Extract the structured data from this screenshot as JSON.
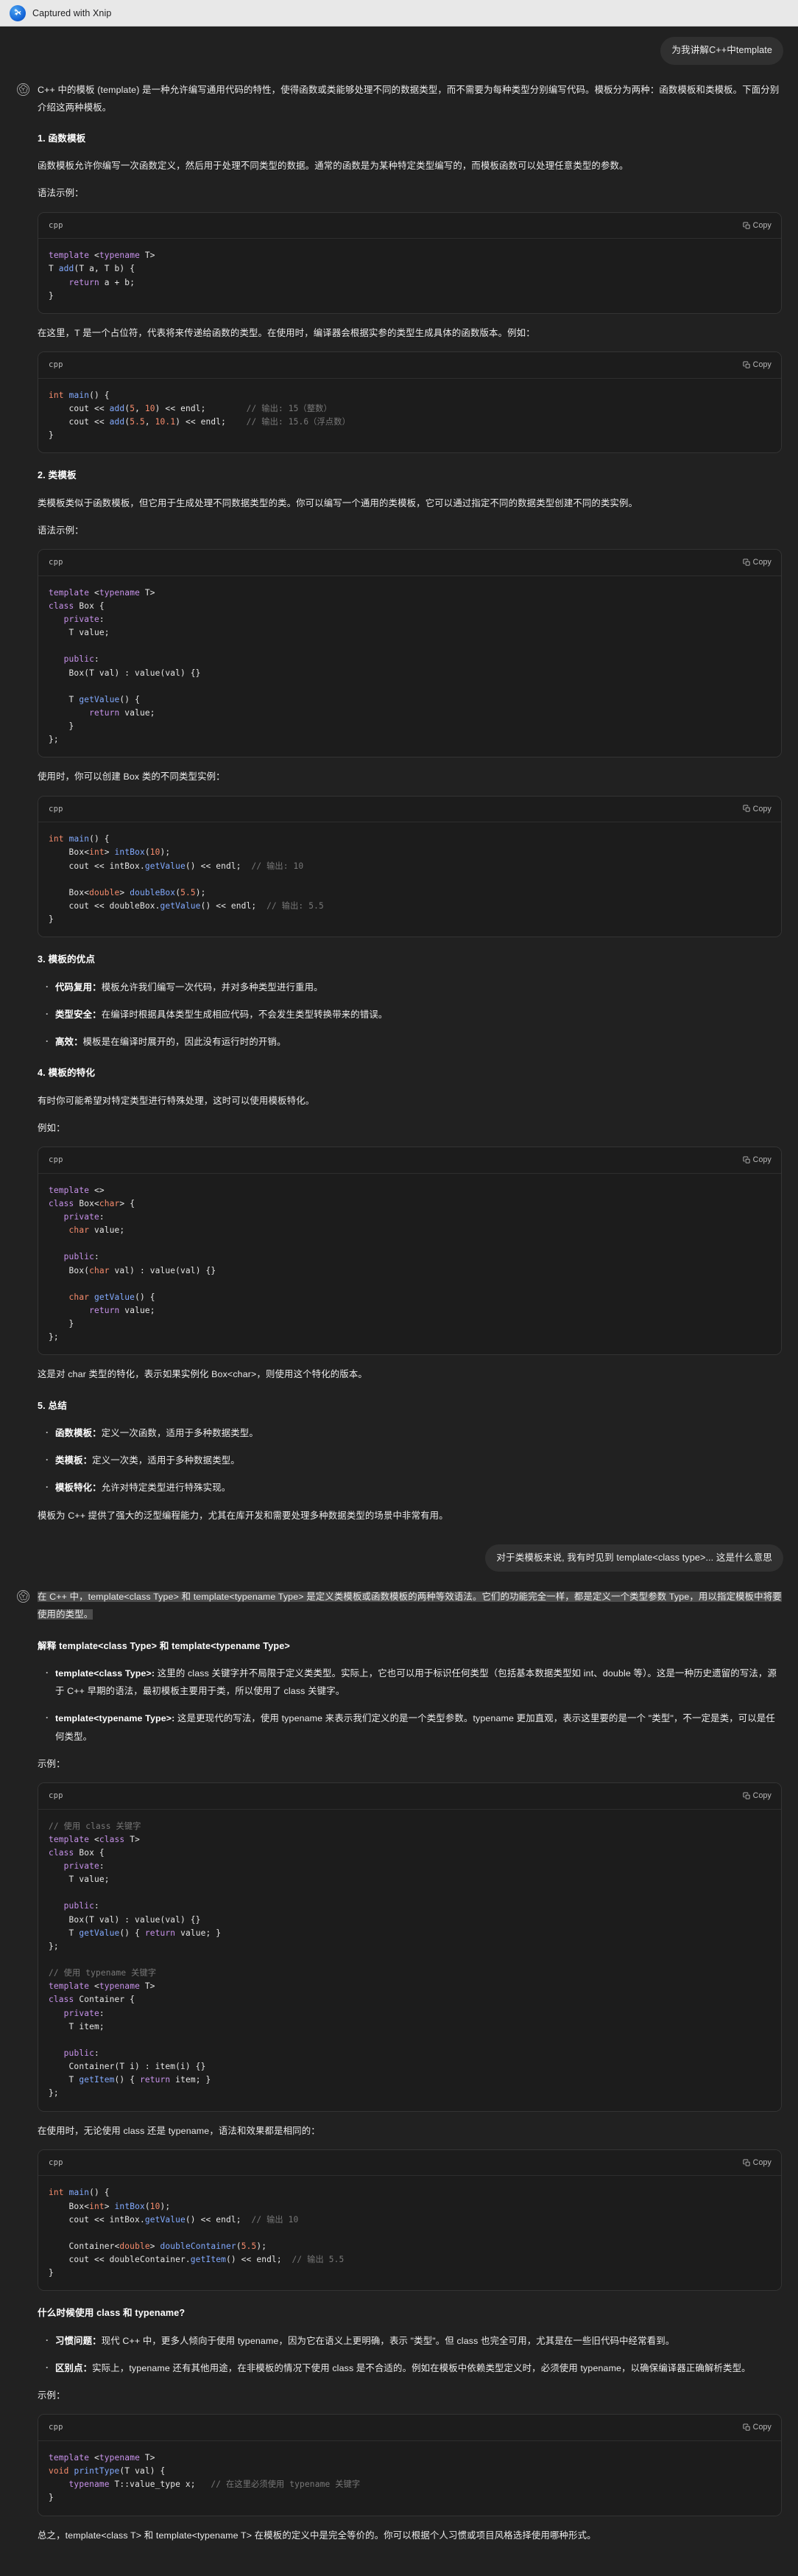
{
  "titlebar": {
    "app_name": "Captured with Xnip",
    "logo_icon": "xnip-scissors-icon"
  },
  "code_ui": {
    "lang_label": "cpp",
    "copy_label": "Copy",
    "copy_icon": "copy-icon"
  },
  "conversation": [
    {
      "role": "user",
      "text": "为我讲解C++中template"
    },
    {
      "role": "assistant",
      "blocks": [
        {
          "type": "p",
          "text": "C++ 中的模板 (template) 是一种允许编写通用代码的特性，使得函数或类能够处理不同的数据类型，而不需要为每种类型分别编写代码。模板分为两种：函数模板和类模板。下面分别介绍这两种模板。"
        },
        {
          "type": "h3",
          "text": "1. 函数模板"
        },
        {
          "type": "p",
          "text": "函数模板允许你编写一次函数定义，然后用于处理不同类型的数据。通常的函数是为某种特定类型编写的，而模板函数可以处理任意类型的参数。"
        },
        {
          "type": "p",
          "text": "语法示例："
        },
        {
          "type": "code",
          "lang": "cpp",
          "lines": "template <typename T>\nT add(T a, T b) {\n    return a + b;\n}"
        },
        {
          "type": "p",
          "text": "在这里，T 是一个占位符，代表将来传递给函数的类型。在使用时，编译器会根据实参的类型生成具体的函数版本。例如："
        },
        {
          "type": "code",
          "lang": "cpp",
          "lines": "int main() {\n    cout << add(5, 10) << endl;        // 输出: 15（整数）\n    cout << add(5.5, 10.1) << endl;    // 输出: 15.6（浮点数）\n}"
        },
        {
          "type": "h3",
          "text": "2. 类模板"
        },
        {
          "type": "p",
          "text": "类模板类似于函数模板，但它用于生成处理不同数据类型的类。你可以编写一个通用的类模板，它可以通过指定不同的数据类型创建不同的类实例。"
        },
        {
          "type": "p",
          "text": "语法示例："
        },
        {
          "type": "code",
          "lang": "cpp",
          "lines": "template <typename T>\nclass Box {\n   private:\n    T value;\n\n   public:\n    Box(T val) : value(val) {}\n\n    T getValue() {\n        return value;\n    }\n};"
        },
        {
          "type": "p",
          "text": "使用时，你可以创建 Box 类的不同类型实例："
        },
        {
          "type": "code",
          "lang": "cpp",
          "lines": "int main() {\n    Box<int> intBox(10);\n    cout << intBox.getValue() << endl;  // 输出: 10\n\n    Box<double> doubleBox(5.5);\n    cout << doubleBox.getValue() << endl;  // 输出: 5.5\n}"
        },
        {
          "type": "h3",
          "text": "3. 模板的优点"
        },
        {
          "type": "ul",
          "items": [
            {
              "bold": "代码复用：",
              "text": "模板允许我们编写一次代码，并对多种类型进行重用。"
            },
            {
              "bold": "类型安全：",
              "text": "在编译时根据具体类型生成相应代码，不会发生类型转换带来的错误。"
            },
            {
              "bold": "高效：",
              "text": "模板是在编译时展开的，因此没有运行时的开销。"
            }
          ]
        },
        {
          "type": "h3",
          "text": "4. 模板的特化"
        },
        {
          "type": "p",
          "text": "有时你可能希望对特定类型进行特殊处理，这时可以使用模板特化。"
        },
        {
          "type": "p",
          "text": "例如："
        },
        {
          "type": "code",
          "lang": "cpp",
          "lines": "template <>\nclass Box<char> {\n   private:\n    char value;\n\n   public:\n    Box(char val) : value(val) {}\n\n    char getValue() {\n        return value;\n    }\n};"
        },
        {
          "type": "p",
          "text": "这是对 char 类型的特化，表示如果实例化 Box<char>，则使用这个特化的版本。"
        },
        {
          "type": "h3",
          "text": "5. 总结"
        },
        {
          "type": "ul",
          "items": [
            {
              "bold": "函数模板：",
              "text": "定义一次函数，适用于多种数据类型。"
            },
            {
              "bold": "类模板：",
              "text": "定义一次类，适用于多种数据类型。"
            },
            {
              "bold": "模板特化：",
              "text": "允许对特定类型进行特殊实现。"
            }
          ]
        },
        {
          "type": "p",
          "text": "模板为 C++ 提供了强大的泛型编程能力，尤其在库开发和需要处理多种数据类型的场景中非常有用。"
        }
      ]
    },
    {
      "role": "user",
      "text": "对于类模板来说, 我有时见到 template<class type>... 这是什么意思"
    },
    {
      "role": "assistant",
      "blocks": [
        {
          "type": "p",
          "selected": true,
          "text": "在 C++ 中，template<class Type> 和 template<typename Type> 是定义类模板或函数模板的两种等效语法。它们的功能完全一样，都是定义一个类型参数 Type，用以指定模板中将要使用的类型。"
        },
        {
          "type": "h3",
          "text": "解释 template<class Type> 和 template<typename Type>"
        },
        {
          "type": "ul",
          "items": [
            {
              "bold": "template<class Type>:",
              "text": " 这里的 class 关键字并不局限于定义类类型。实际上，它也可以用于标识任何类型（包括基本数据类型如 int、double 等）。这是一种历史遗留的写法，源于 C++ 早期的语法，最初模板主要用于类，所以使用了 class 关键字。"
            },
            {
              "bold": "template<typename Type>:",
              "text": " 这是更现代的写法，使用 typename 来表示我们定义的是一个类型参数。typename 更加直观，表示这里要的是一个 \"类型\"，不一定是类，可以是任何类型。"
            }
          ]
        },
        {
          "type": "p",
          "text": "示例："
        },
        {
          "type": "code",
          "lang": "cpp",
          "lines": "// 使用 class 关键字\ntemplate <class T>\nclass Box {\n   private:\n    T value;\n\n   public:\n    Box(T val) : value(val) {}\n    T getValue() { return value; }\n};\n\n// 使用 typename 关键字\ntemplate <typename T>\nclass Container {\n   private:\n    T item;\n\n   public:\n    Container(T i) : item(i) {}\n    T getItem() { return item; }\n};"
        },
        {
          "type": "p",
          "text": "在使用时，无论使用 class 还是 typename，语法和效果都是相同的："
        },
        {
          "type": "code",
          "lang": "cpp",
          "lines": "int main() {\n    Box<int> intBox(10);\n    cout << intBox.getValue() << endl;  // 输出 10\n\n    Container<double> doubleContainer(5.5);\n    cout << doubleContainer.getItem() << endl;  // 输出 5.5\n}"
        },
        {
          "type": "h3",
          "text": "什么时候使用 class 和 typename?"
        },
        {
          "type": "ul",
          "items": [
            {
              "bold": "习惯问题：",
              "text": "现代 C++ 中，更多人倾向于使用 typename，因为它在语义上更明确，表示 \"类型\"。但 class 也完全可用，尤其是在一些旧代码中经常看到。"
            },
            {
              "bold": "区别点：",
              "text": "实际上，typename 还有其他用途，在非模板的情况下使用 class 是不合适的。例如在模板中依赖类型定义时，必须使用 typename，以确保编译器正确解析类型。"
            }
          ]
        },
        {
          "type": "p",
          "text": "示例："
        },
        {
          "type": "code",
          "lang": "cpp",
          "lines": "template <typename T>\nvoid printType(T val) {\n    typename T::value_type x;   // 在这里必须使用 typename 关键字\n}"
        },
        {
          "type": "p",
          "text": "总之，template<class T> 和 template<typename T> 在模板的定义中是完全等价的。你可以根据个人习惯或项目风格选择使用哪种形式。"
        }
      ]
    }
  ]
}
